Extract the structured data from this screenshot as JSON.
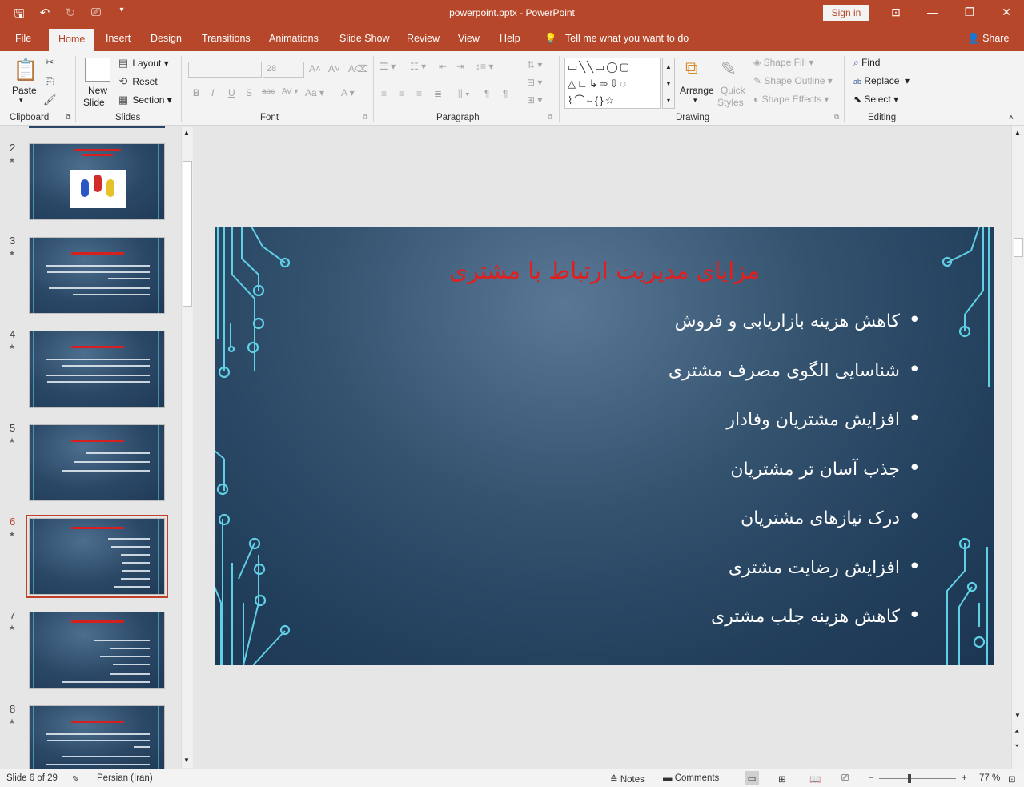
{
  "titlebar": {
    "doc_title": "powerpoint.pptx  -  PowerPoint",
    "signin": "Sign in",
    "qat_icons": [
      "save-icon",
      "undo-icon",
      "redo-icon",
      "present-icon",
      "customize-icon"
    ],
    "accent": "#b7472a"
  },
  "tabs": {
    "file": "File",
    "home": "Home",
    "insert": "Insert",
    "design": "Design",
    "transitions": "Transitions",
    "animations": "Animations",
    "slideshow": "Slide Show",
    "review": "Review",
    "view": "View",
    "help": "Help",
    "tellme": "Tell me what you want to do",
    "share": "Share"
  },
  "ribbon": {
    "clipboard": {
      "paste": "Paste",
      "label": "Clipboard"
    },
    "slides": {
      "new_slide_1": "New",
      "new_slide_2": "Slide",
      "layout": "Layout",
      "reset": "Reset",
      "section": "Section",
      "label": "Slides"
    },
    "font": {
      "font_name": "",
      "font_size": "28",
      "label": "Font"
    },
    "paragraph": {
      "label": "Paragraph"
    },
    "drawing": {
      "arrange": "Arrange",
      "quick_styles_1": "Quick",
      "quick_styles_2": "Styles",
      "shape_fill": "Shape Fill",
      "shape_outline": "Shape Outline",
      "shape_effects": "Shape Effects",
      "label": "Drawing"
    },
    "editing": {
      "find": "Find",
      "replace": "Replace",
      "select": "Select",
      "label": "Editing"
    }
  },
  "thumbnails": [
    {
      "num": "2",
      "star": "★",
      "selected": false
    },
    {
      "num": "3",
      "star": "★",
      "selected": false
    },
    {
      "num": "4",
      "star": "★",
      "selected": false
    },
    {
      "num": "5",
      "star": "★",
      "selected": false
    },
    {
      "num": "6",
      "star": "★",
      "selected": true
    },
    {
      "num": "7",
      "star": "★",
      "selected": false
    },
    {
      "num": "8",
      "star": "★",
      "selected": false
    }
  ],
  "slide": {
    "title": "مزایای مدیریت ارتباط با مشتری",
    "bullets": [
      "کاهش هزینه بازاریابی و فروش",
      "شناسایی الگوی مصرف  مشتری",
      "افزایش مشتریان وفادار",
      "جذب آسان تر مشتریان",
      "درک نیازهای مشتریان",
      "افزایش رضایت مشتری",
      "کاهش هزینه جلب مشتری"
    ],
    "title_color": "#e01f1f",
    "circuit_color": "#5fd0e6"
  },
  "statusbar": {
    "slide_info": "Slide 6 of 29",
    "language": "Persian (Iran)",
    "notes": "Notes",
    "comments": "Comments",
    "zoom": "77 %",
    "minus": "−",
    "plus": "+"
  }
}
